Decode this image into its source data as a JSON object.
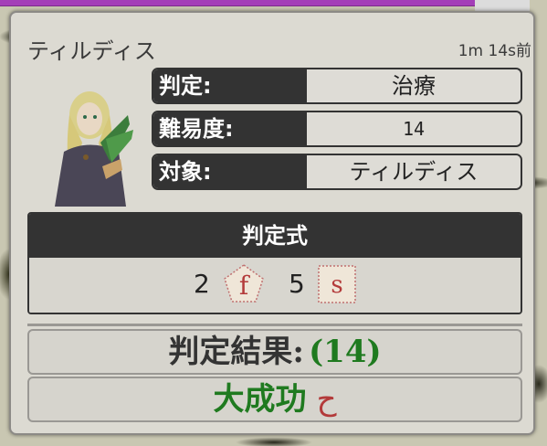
{
  "message": {
    "character_name": "ティルディス",
    "timestamp": "1m 14s前"
  },
  "check": {
    "rows": [
      {
        "label": "判定:",
        "value": "治療"
      },
      {
        "label": "難易度:",
        "value": "14"
      },
      {
        "label": "対象:",
        "value": "ティルディス"
      }
    ]
  },
  "formula": {
    "header": "判定式",
    "dice": [
      {
        "count": "2",
        "symbol": "f",
        "icon": "fortune-die-icon",
        "color": "#b33a3a"
      },
      {
        "count": "5",
        "symbol": "s",
        "icon": "skill-die-icon",
        "color": "#b33a3a"
      }
    ]
  },
  "result": {
    "label": "判定結果:",
    "value": "(14)",
    "outcome": "大成功",
    "outcome_symbol": "ح",
    "value_color": "#1f7a1f"
  }
}
